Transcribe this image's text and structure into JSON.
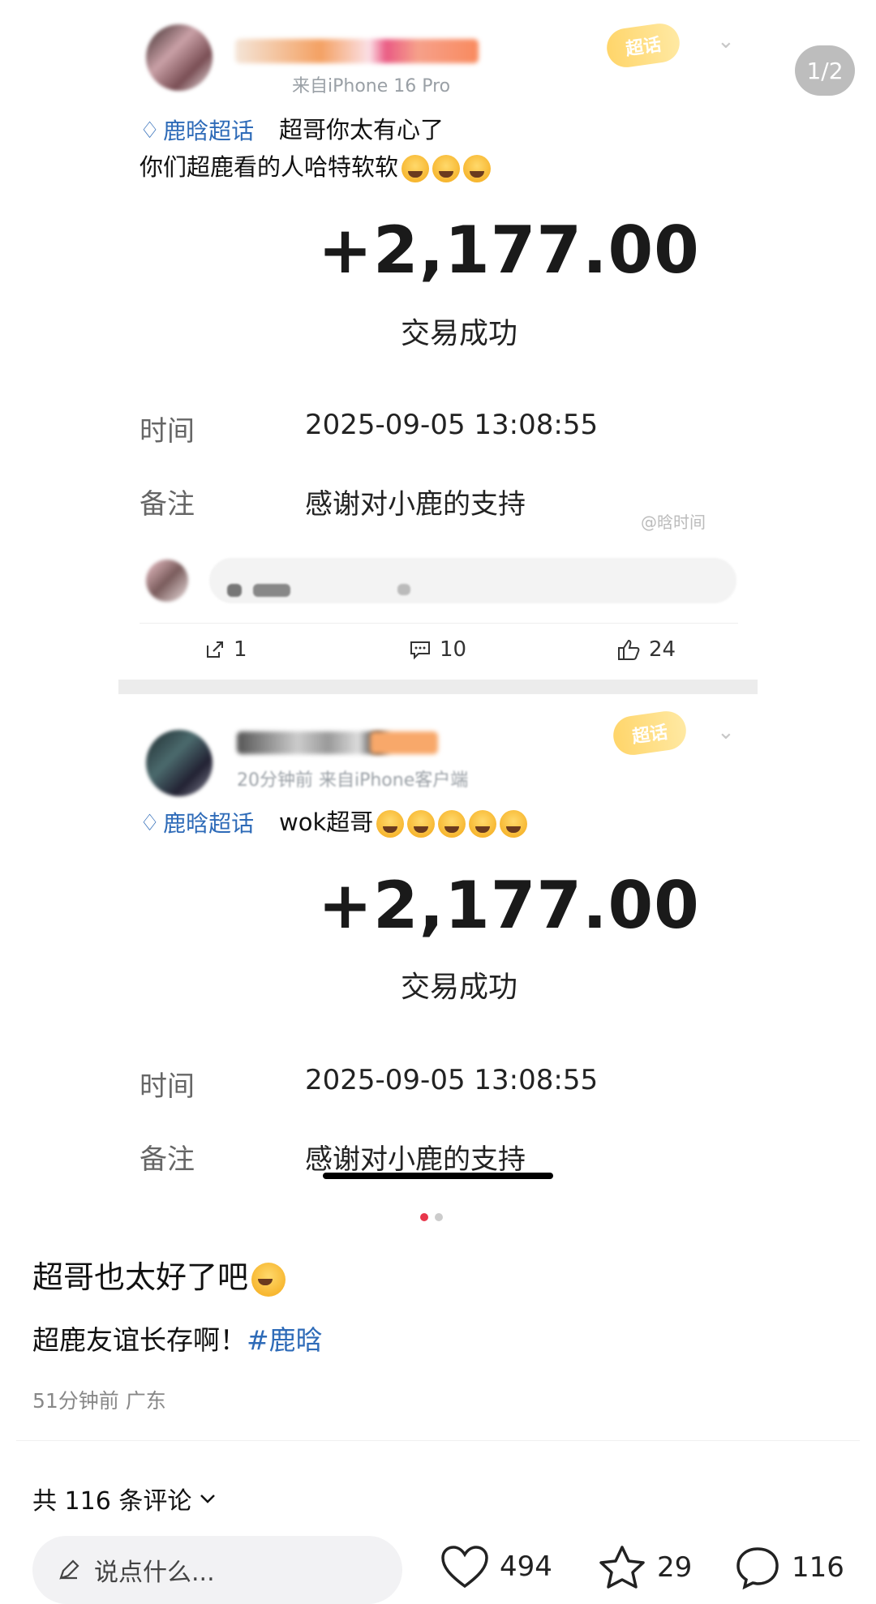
{
  "page_counter": "1/2",
  "posts": [
    {
      "meta": "来自iPhone 16 Pro",
      "supertopic_label": "鹿晗超话",
      "chip_label": "超话",
      "text_line1": "超哥你太有心了",
      "text_line2": "你们超鹿看的人哈特软软",
      "amount": "+2,177.00",
      "status": "交易成功",
      "rows": [
        {
          "label": "时间",
          "value": "2025-09-05 13:08:55"
        },
        {
          "label": "备注",
          "value": "感谢对小鹿的支持"
        }
      ],
      "watermark": "@晗时间",
      "actions": {
        "share": "1",
        "comment": "10",
        "like": "24"
      }
    },
    {
      "meta": "20分钟前 来自iPhone客户端",
      "supertopic_label": "鹿晗超话",
      "chip_label": "超话",
      "text_line1": "wok超哥",
      "amount": "+2,177.00",
      "status": "交易成功",
      "rows": [
        {
          "label": "时间",
          "value": "2025-09-05 13:08:55"
        },
        {
          "label": "备注",
          "value": "感谢对小鹿的支持"
        }
      ]
    }
  ],
  "carousel": {
    "active_color": "#e8364b",
    "inactive_color": "#cccccc"
  },
  "caption": {
    "title": "超哥也太好了吧",
    "line_text": "超鹿友谊长存啊！",
    "hashtag": "#鹿晗",
    "time_loc": "51分钟前  广东"
  },
  "comments_header": "共 116 条评论",
  "bottom_bar": {
    "input_placeholder": "说点什么...",
    "likes": "494",
    "favorites": "29",
    "comments": "116"
  },
  "colors": {
    "link_blue": "#2e6bb8",
    "chip_yellow": "#ffd56a"
  }
}
